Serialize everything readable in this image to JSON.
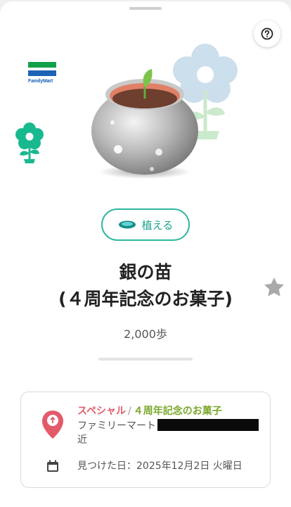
{
  "store": {
    "logo_text": "FamilyMart"
  },
  "plant_button": {
    "label": "植える"
  },
  "item": {
    "title_line1": "銀の苗",
    "title_line2": "(４周年記念のお菓子)",
    "steps": "2,000歩"
  },
  "card": {
    "category": "スペシャル",
    "separator": "/",
    "category_name": "４周年記念のお菓子",
    "location": "ファミリーマート",
    "location_suffix": "近",
    "found_label": "見つけた日：",
    "found_date": "2025年12月2日 火曜日"
  },
  "colors": {
    "accent": "#2fb7a0",
    "special": "#e35a6a",
    "category_name": "#7aa82c",
    "pin": "#e35a6a"
  },
  "icons": {
    "help": "question-circle-icon",
    "star": "star-icon",
    "pin": "location-pin-icon",
    "calendar": "calendar-icon",
    "plant": "pot-dish-icon"
  }
}
